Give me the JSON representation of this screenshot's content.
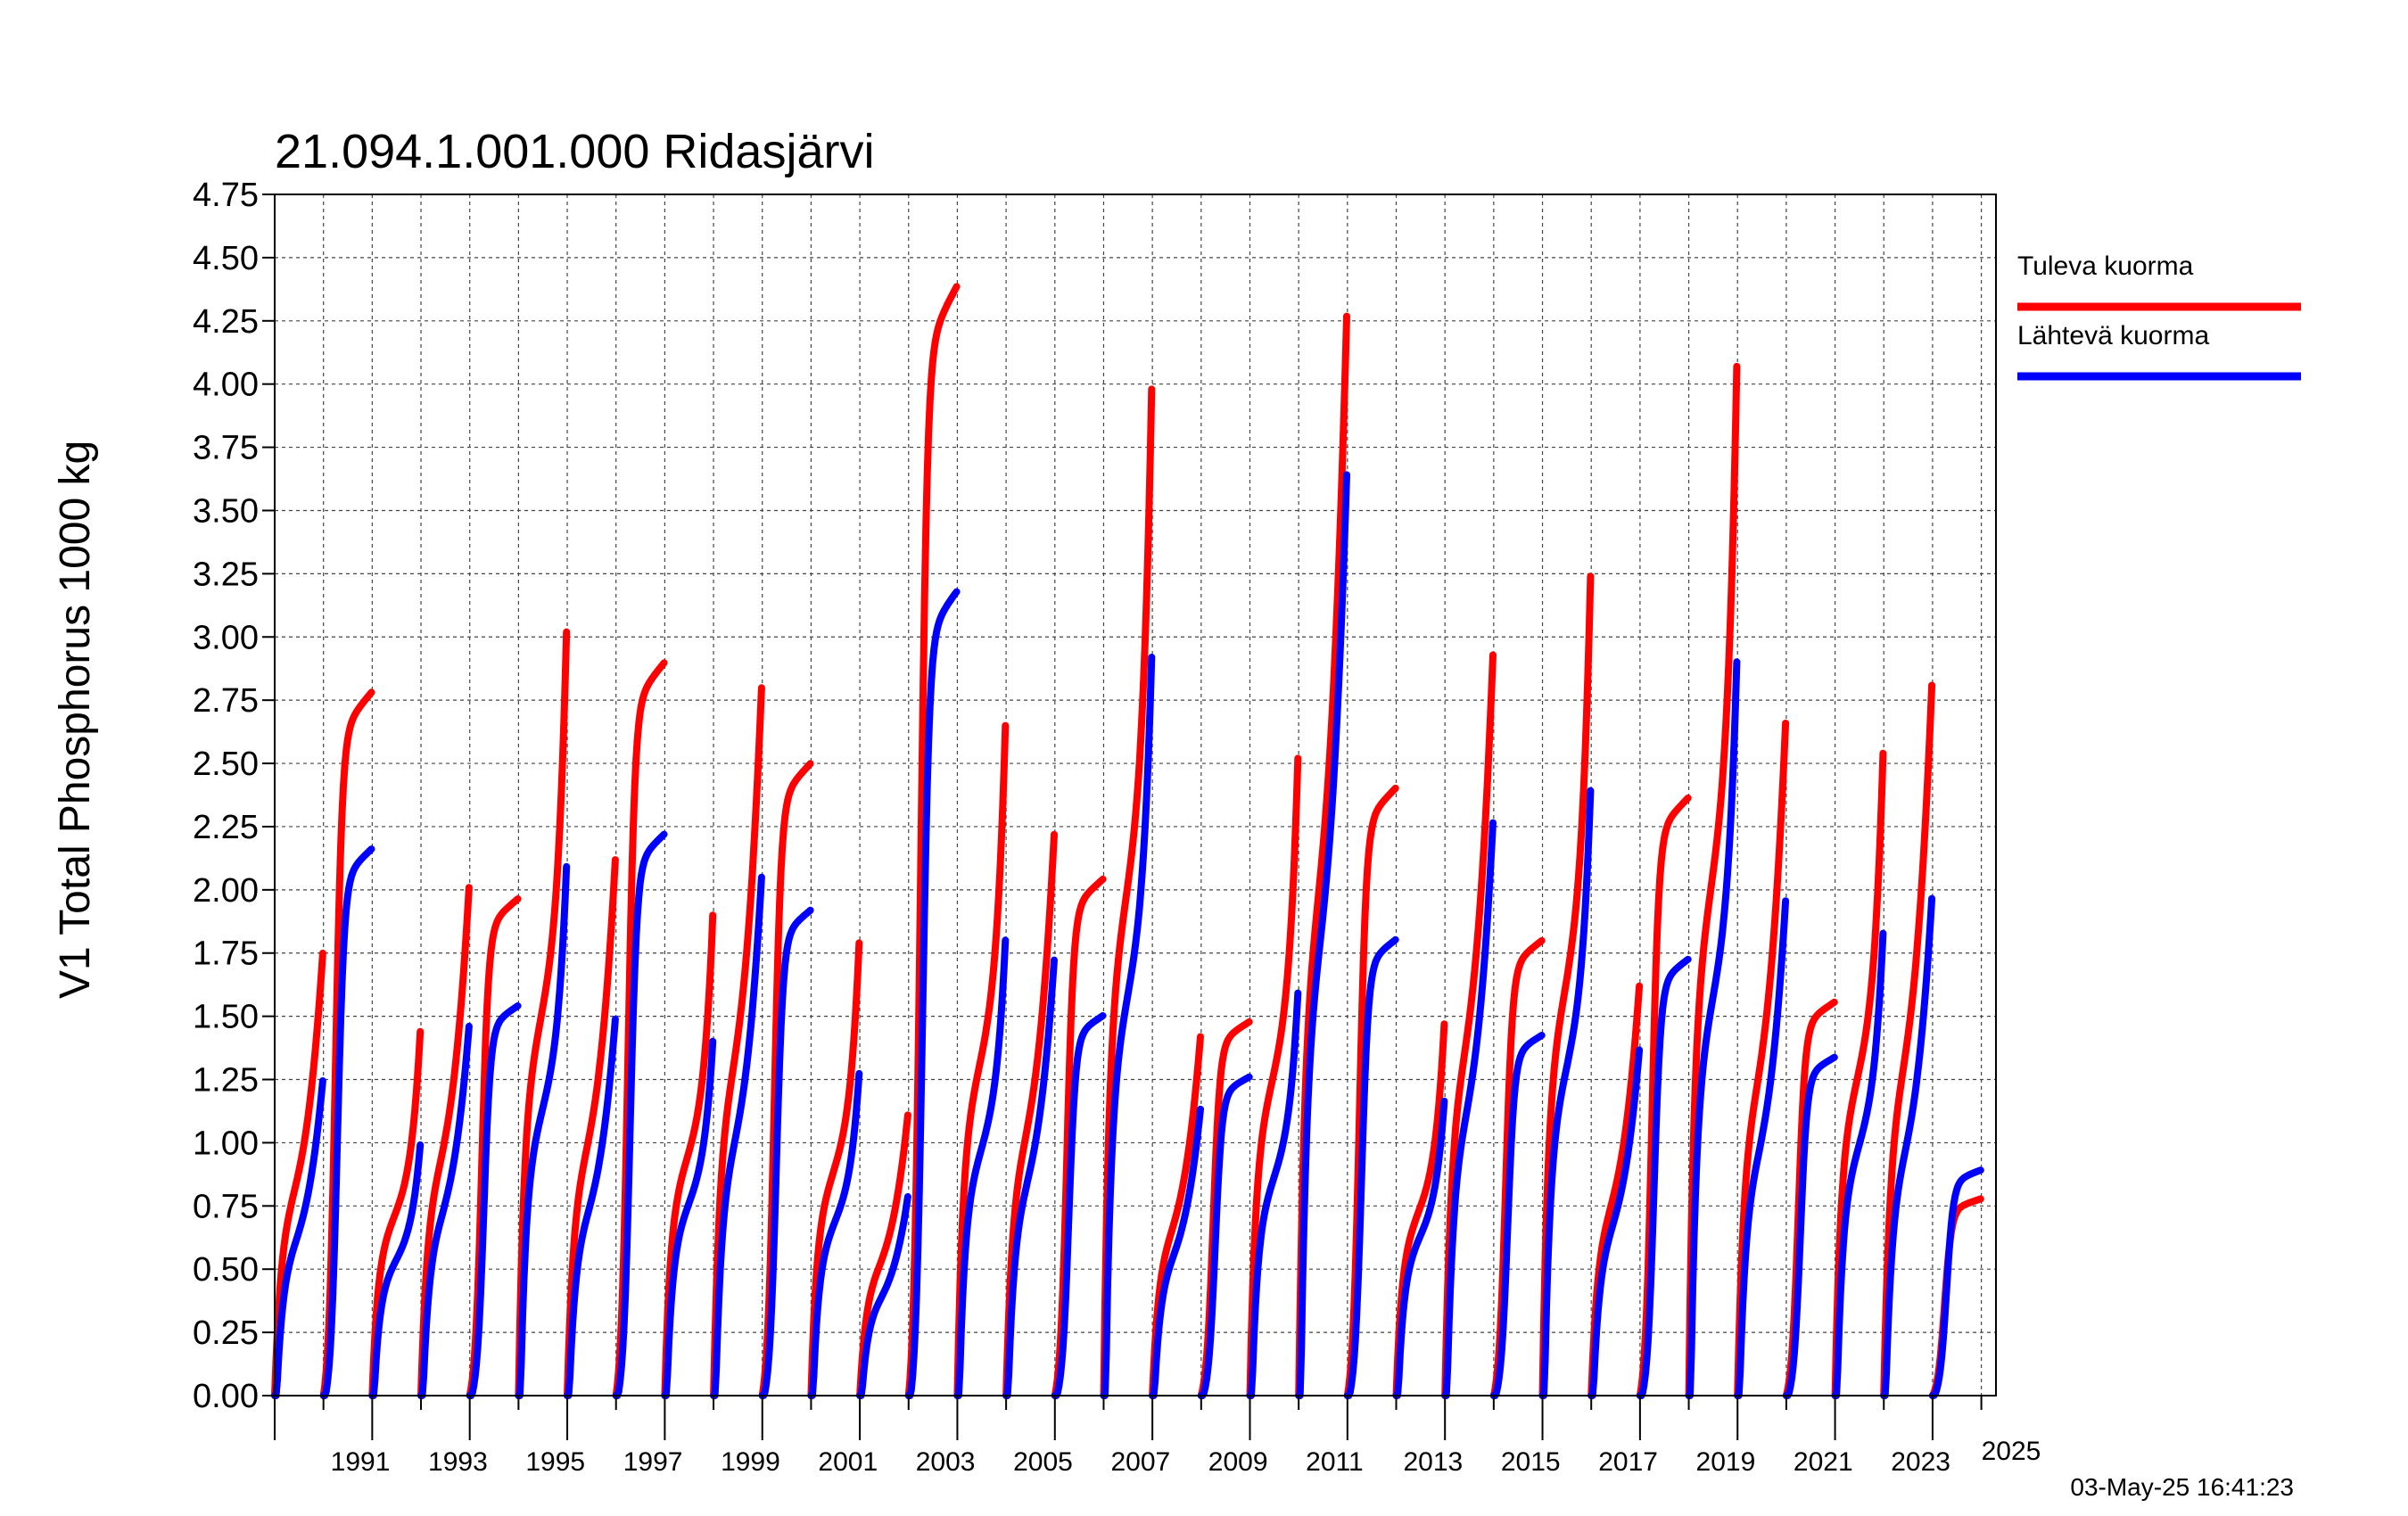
{
  "chart_data": {
    "type": "line",
    "title": "21.094.1.001.000 Ridasjärvi",
    "ylabel": "V1 Total Phosphorus 1000 kg",
    "xlabel": "",
    "xlim": [
      1990,
      2025.3
    ],
    "ylim": [
      0,
      4.75
    ],
    "ytick_labels": [
      "0.00",
      "0.25",
      "0.50",
      "0.75",
      "1.00",
      "1.25",
      "1.50",
      "1.75",
      "2.00",
      "2.25",
      "2.50",
      "2.75",
      "3.00",
      "3.25",
      "3.50",
      "3.75",
      "4.00",
      "4.25",
      "4.50",
      "4.75"
    ],
    "xtick_labels": [
      "1991",
      "1993",
      "1995",
      "1997",
      "1999",
      "2001",
      "2003",
      "2005",
      "2007",
      "2009",
      "2011",
      "2013",
      "2015",
      "2017",
      "2019",
      "2021",
      "2023",
      "2025"
    ],
    "grid": true,
    "legend_position": "right",
    "timestamp": "03-May-25 16:41:23",
    "series": [
      {
        "name": "Tuleva kuorma",
        "color": "#ff0000",
        "annual_totals": [
          1.75,
          2.86,
          1.44,
          2.01,
          2.02,
          3.02,
          2.12,
          2.98,
          1.9,
          2.8,
          2.57,
          1.79,
          1.11,
          4.51,
          2.65,
          2.22,
          2.1,
          3.98,
          1.42,
          1.52,
          2.52,
          4.27,
          2.47,
          1.47,
          2.93,
          1.85,
          3.24,
          1.62,
          2.43,
          4.07,
          2.66,
          1.6,
          2.54,
          2.81,
          0.8
        ]
      },
      {
        "name": "Lähtevä kuorma",
        "color": "#0000ff",
        "annual_totals": [
          1.33,
          2.23,
          1.09,
          1.56,
          1.59,
          2.3,
          1.59,
          2.29,
          1.54,
          2.19,
          1.98,
          1.4,
          0.84,
          3.28,
          1.98,
          1.84,
          1.55,
          3.21,
          1.21,
          1.3,
          1.75,
          3.89,
          1.86,
          1.28,
          2.42,
          1.47,
          2.63,
          1.46,
          1.78,
          3.19,
          2.09,
          1.38,
          2.01,
          2.1,
          0.92
        ]
      }
    ]
  }
}
